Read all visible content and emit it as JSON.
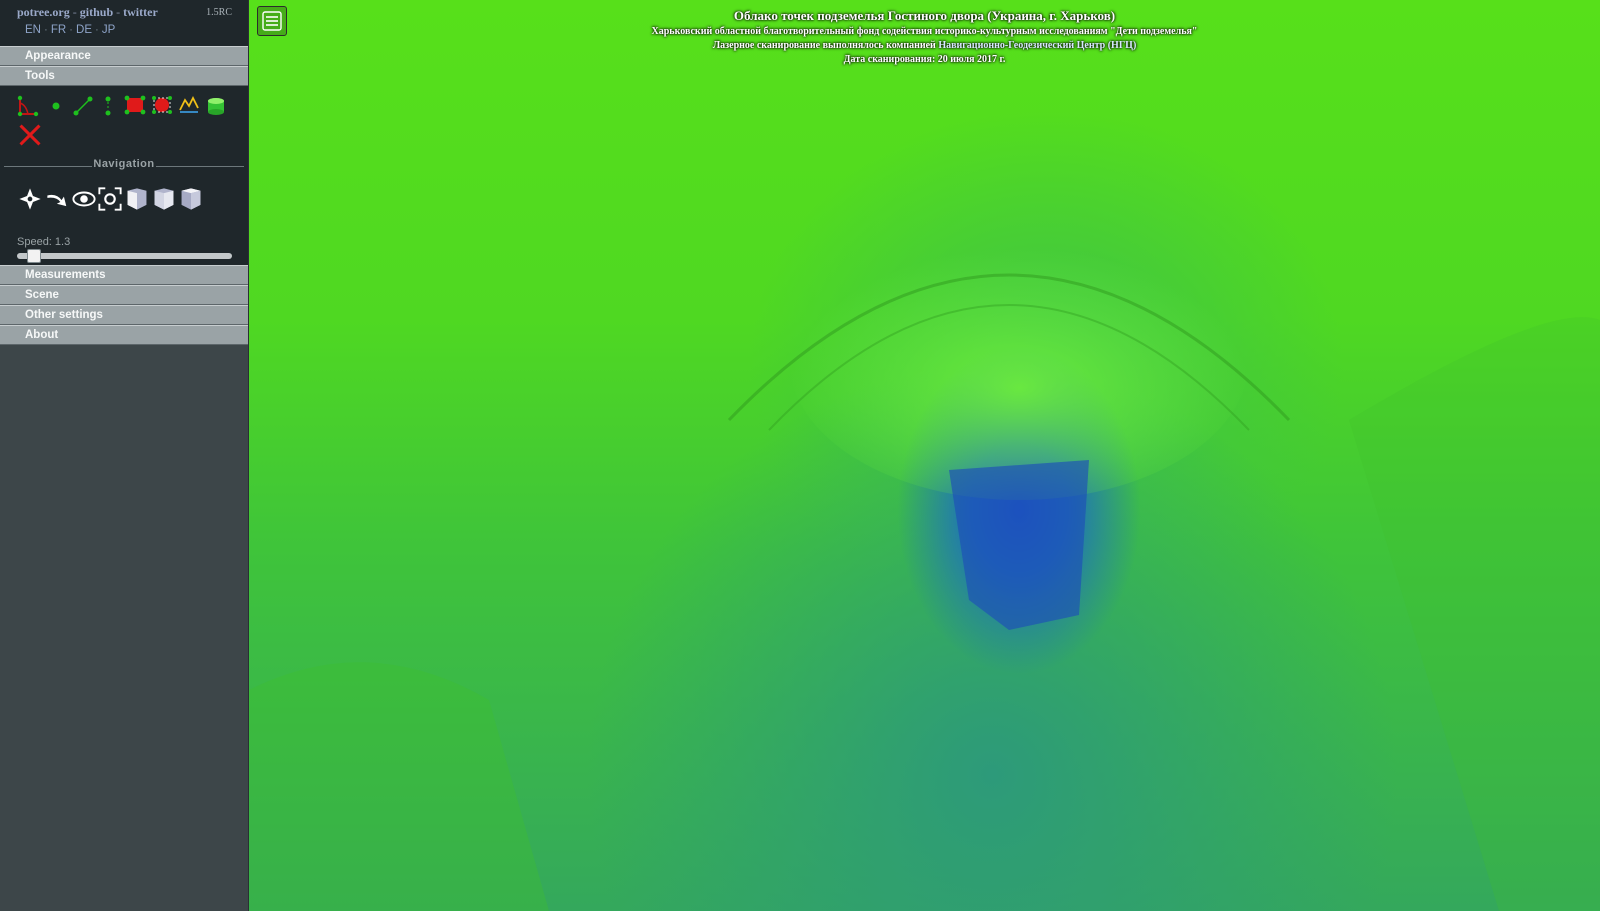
{
  "sidebar": {
    "brand": {
      "potree": "potree.org",
      "github": "github",
      "twitter": "twitter",
      "sep": "-"
    },
    "version": "1.5RC",
    "languages": [
      "EN",
      "FR",
      "DE",
      "JP"
    ],
    "sections": {
      "appearance": "Appearance",
      "tools": "Tools",
      "navigation": "Navigation",
      "measurements": "Measurements",
      "scene": "Scene",
      "other_settings": "Other settings",
      "about": "About"
    },
    "speed_label": "Speed: 1.3",
    "speed_value": 1.3
  },
  "viewer": {
    "title": "Облако точек подземелья Гостиного двора (Украина, г. Харьков)",
    "subtitle": "Харьковский областной благотворительный фонд содействия историко-культурным исследованиям \"Дети подземелья\"",
    "scan_prefix": "Лазерное сканирование выполнялось компанией",
    "scan_company": "Навигационно-Геодезический Центр (НГЦ)",
    "scan_date": "Дата сканирования: 20 июля 2017 г."
  },
  "colors": {
    "sidebar_bg": "#3d4649",
    "panel_bg": "#1f272b",
    "accordion": "#9aa3a6",
    "point_high": "#57e01a",
    "point_low": "#1c58c9"
  }
}
